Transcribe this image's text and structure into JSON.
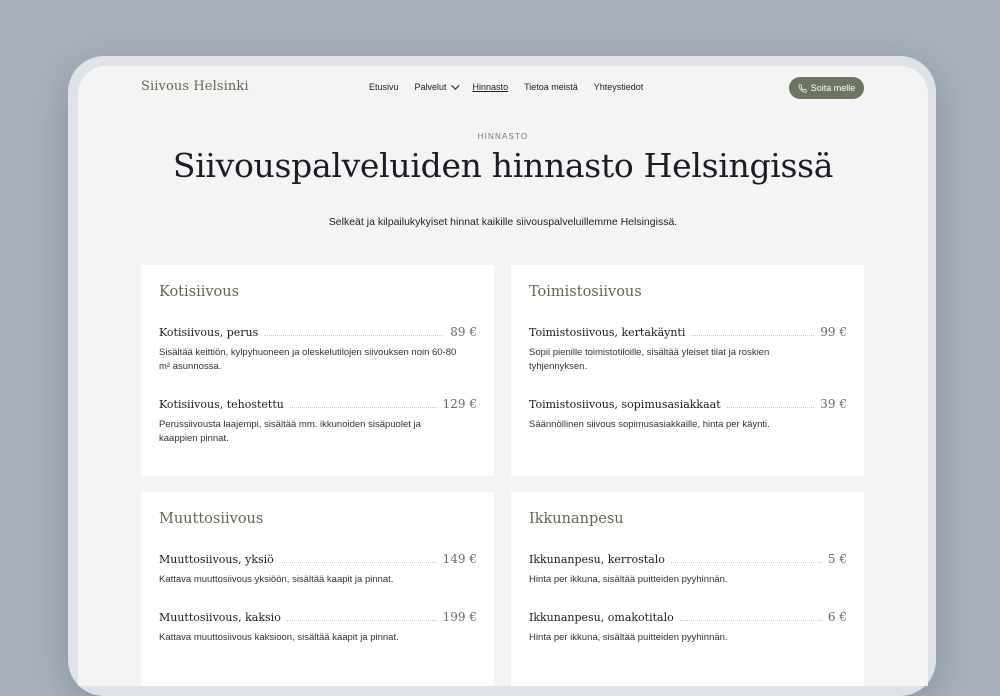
{
  "nav": {
    "logo": "Siivous Helsinki",
    "items": [
      {
        "label": "Etusivu"
      },
      {
        "label": "Palvelut"
      },
      {
        "label": "Hinnasto"
      },
      {
        "label": "Tietoa meistä"
      },
      {
        "label": "Yhteystiedot"
      }
    ],
    "cta": "Soita melle"
  },
  "hero": {
    "eyebrow": "HINNASTO",
    "title": "Siivouspalveluiden hinnasto Helsingissä",
    "lead": "Selkeät ja kilpailukykyiset hinnat kaikille siivouspalveluillemme Helsingissä."
  },
  "cards": [
    {
      "title": "Kotisiivous",
      "items": [
        {
          "name": "Kotisiivous, perus",
          "price": "89 €",
          "desc": "Sisältää keittiön, kylpyhuoneen ja oleskelutilojen siivouksen noin 60-80 m² asunnossa."
        },
        {
          "name": "Kotisiivous, tehostettu",
          "price": "129 €",
          "desc": "Perussiivousta laajempi, sisältää mm. ikkunoiden sisäpuolet ja kaappien pinnat."
        }
      ]
    },
    {
      "title": "Toimistosiivous",
      "items": [
        {
          "name": "Toimistosiivous, kertakäynti",
          "price": "99 €",
          "desc": "Sopii pienille toimistotiloille, sisältää yleiset tilat ja roskien tyhjennyksen."
        },
        {
          "name": "Toimistosiivous, sopimusasiakkaat",
          "price": "39 €",
          "desc": "Säännöllinen siivous sopimusasiakkaille, hinta per käynti."
        }
      ]
    },
    {
      "title": "Muuttosiivous",
      "items": [
        {
          "name": "Muuttosiivous, yksiö",
          "price": "149 €",
          "desc": "Kattava muuttosiivous yksiöön, sisältää kaapit ja pinnat."
        },
        {
          "name": "Muuttosiivous, kaksio",
          "price": "199 €",
          "desc": "Kattava muuttosiivous kaksioon, sisältää kaapit ja pinnat."
        }
      ]
    },
    {
      "title": "Ikkunanpesu",
      "items": [
        {
          "name": "Ikkunanpesu, kerrostalo",
          "price": "5 €",
          "desc": "Hinta per ikkuna, sisältää puitteiden pyyhinnän."
        },
        {
          "name": "Ikkunanpesu, omakotitalo",
          "price": "6 €",
          "desc": "Hinta per ikkuna, sisältää puitteiden pyyhinnän."
        }
      ]
    }
  ],
  "colors": {
    "accent": "#6b7560",
    "heading": "#5f6a52",
    "background": "#f4f4f4"
  }
}
